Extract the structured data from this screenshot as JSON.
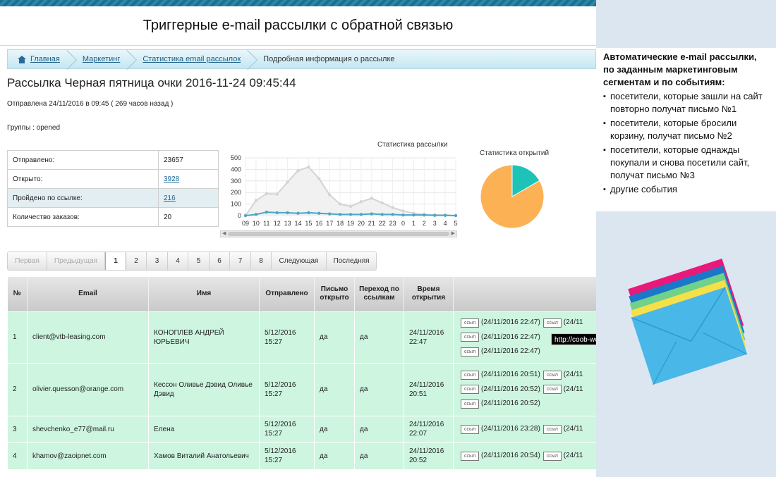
{
  "slide_title": "Триггерные e-mail рассылки с обратной связью",
  "breadcrumb": {
    "items": [
      "Главная",
      "Маркетинг",
      "Статистика email рассылок"
    ],
    "current": "Подробная информация о рассылке"
  },
  "page": {
    "title": "Рассылка Черная пятница очки 2016-11-24 09:45:44",
    "sent_info": "Отправлена 24/11/2016 в 09:45 ( 269 часов назад )",
    "groups": "Группы : opened"
  },
  "stats": [
    {
      "label": "Отправлено:",
      "value": "23657",
      "link": false
    },
    {
      "label": "Открыто:",
      "value": "3928",
      "link": true
    },
    {
      "label": "Пройдено по ссылке:",
      "value": "216",
      "link": true
    },
    {
      "label": "Количество заказов:",
      "value": "20",
      "link": false
    }
  ],
  "chart_data": [
    {
      "type": "line",
      "title": "Статистика рассылки",
      "x": [
        "09",
        "10",
        "11",
        "12",
        "13",
        "14",
        "15",
        "16",
        "17",
        "18",
        "19",
        "20",
        "21",
        "22",
        "23",
        "0",
        "1",
        "2",
        "3",
        "4",
        "5"
      ],
      "ylim": [
        0,
        500
      ],
      "yticks": [
        0,
        100,
        200,
        300,
        400,
        500
      ],
      "grid": true,
      "series": [
        {
          "values": [
            0,
            130,
            190,
            185,
            290,
            390,
            420,
            320,
            180,
            100,
            80,
            120,
            150,
            110,
            70,
            40,
            20,
            10,
            5,
            5,
            0
          ]
        },
        {
          "values": [
            0,
            10,
            30,
            25,
            25,
            20,
            25,
            20,
            15,
            10,
            10,
            10,
            15,
            10,
            10,
            5,
            5,
            5,
            2,
            2,
            0
          ]
        }
      ],
      "colors": [
        "#d4d4d4",
        "#4aa7c4"
      ]
    },
    {
      "type": "pie",
      "title": "Статистика открытий",
      "values": [
        16.6,
        83.4
      ],
      "colors": [
        "#1ec3b8",
        "#fcb254"
      ]
    }
  ],
  "pager": {
    "first": "Первая",
    "prev": "Предыдущая",
    "pages": [
      "1",
      "2",
      "3",
      "4",
      "5",
      "6",
      "7",
      "8"
    ],
    "current": "1",
    "next": "Следующая",
    "last": "Последняя"
  },
  "table": {
    "headers": {
      "num": "№",
      "email": "Email",
      "name": "Имя",
      "sent": "Отправлено",
      "opened": "Письмо открыто",
      "clicked": "Переход по ссылкам",
      "open_time": "Время открытия"
    },
    "rows": [
      {
        "num": "1",
        "email": "client@vtb-leasing.com",
        "name": "КОНОПЛЕВ АНДРЕЙ ЮРЬЕВИЧ",
        "sent": "5/12/2016 15:27",
        "opened": "да",
        "clicked": "да",
        "open_time": "24/11/2016 22:47",
        "clicks": [
          [
            "(24/11/2016 22:47)",
            "(24/11"
          ],
          [
            "(24/11/2016 22:47)",
            ""
          ],
          [
            "(24/11/2016 22:47)",
            ""
          ]
        ]
      },
      {
        "num": "2",
        "email": "olivier.quesson@orange.com",
        "name": "Кессон Оливье Дэвид Оливье Дэвид",
        "sent": "5/12/2016 15:27",
        "opened": "да",
        "clicked": "да",
        "open_time": "24/11/2016 20:51",
        "clicks": [
          [
            "(24/11/2016 20:51)",
            "(24/11"
          ],
          [
            "(24/11/2016 20:52)",
            "(24/11"
          ],
          [
            "(24/11/2016 20:52)",
            ""
          ]
        ]
      },
      {
        "num": "3",
        "email": "shevchenko_e77@mail.ru",
        "name": "Елена",
        "sent": "5/12/2016 15:27",
        "opened": "да",
        "clicked": "да",
        "open_time": "24/11/2016 22:07",
        "clicks": [
          [
            "(24/11/2016 23:28)",
            "(24/11"
          ]
        ]
      },
      {
        "num": "4",
        "email": "khamov@zaoipnet.com",
        "name": "Хамов Виталий Анатольевич",
        "sent": "5/12/2016 15:27",
        "opened": "да",
        "clicked": "да",
        "open_time": "24/11/2016 20:52",
        "clicks": [
          [
            "(24/11/2016 20:54)",
            "(24/11"
          ]
        ]
      }
    ],
    "link_icon_text": "ссыл"
  },
  "tooltip": "http://coob-wo",
  "side": {
    "heading": "Автоматические e-mail рассылки, по заданным маркетинговым сегментам и по событиям:",
    "items": [
      "посетители, которые зашли на сайт повторно получат письмо №1",
      "посетители, которые бросили корзину, получат  письмо №2",
      "посетители, которые однажды покупали и снова посетили сайт, получат письмо №3",
      "другие события"
    ]
  }
}
